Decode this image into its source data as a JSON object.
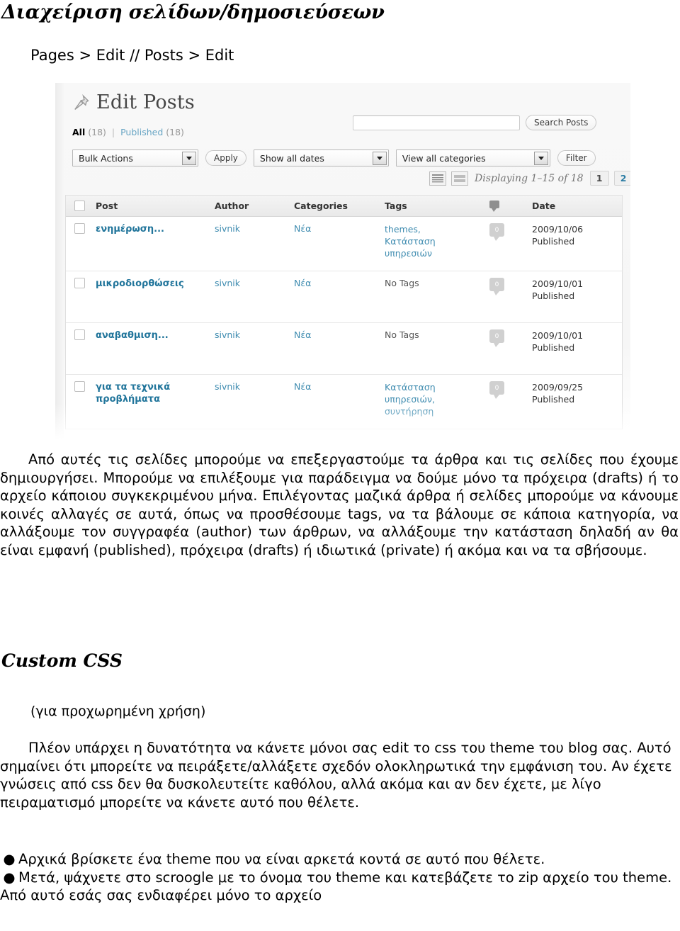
{
  "document": {
    "title": "Διαχείριση σελίδων/δημοσιεύσεων",
    "breadcrumb": "Pages > Edit // Posts > Edit"
  },
  "screenshot": {
    "header": {
      "icon": "pushpin-icon",
      "title": "Edit Posts"
    },
    "filter_links": {
      "all_label": "All",
      "all_count": "(18)",
      "separator": "|",
      "published_label": "Published",
      "published_count": "(18)"
    },
    "search": {
      "value": "",
      "placeholder": "",
      "button_label": "Search Posts"
    },
    "toolbar": {
      "bulk_actions": "Bulk Actions",
      "apply_label": "Apply",
      "show_all_dates": "Show all dates",
      "view_all_categories": "View all categories",
      "filter_label": "Filter"
    },
    "pagination": {
      "list_view_icon": "list-view-icon",
      "excerpt_view_icon": "excerpt-view-icon",
      "displaying": "Displaying 1–15 of 18",
      "page_current": "1",
      "page_next": "2",
      "next_arrow": "»"
    },
    "table": {
      "columns": [
        "Post",
        "Author",
        "Categories",
        "Tags",
        "comments-icon",
        "Date"
      ],
      "headers": {
        "post": "Post",
        "author": "Author",
        "categories": "Categories",
        "tags": "Tags",
        "date": "Date"
      },
      "rows": [
        {
          "post": "ενημέρωση...",
          "author": "sivnik",
          "categories": "Νέα",
          "tags": [
            "themes,",
            "Κατάσταση",
            "υπηρεσιών"
          ],
          "comments": "0",
          "date": "2009/10/06",
          "status": "Published"
        },
        {
          "post": "μικροδιορθώσεις",
          "author": "sivnik",
          "categories": "Νέα",
          "tags": [
            "No Tags"
          ],
          "comments": "0",
          "date": "2009/10/01",
          "status": "Published"
        },
        {
          "post": "αναβαθμιση...",
          "author": "sivnik",
          "categories": "Νέα",
          "tags": [
            "No Tags"
          ],
          "comments": "0",
          "date": "2009/10/01",
          "status": "Published"
        },
        {
          "post": "για τα τεχνικά προβλήματα",
          "author": "sivnik",
          "categories": "Νέα",
          "tags": [
            "Κατάσταση",
            "υπηρεσιών,",
            "συντήρηση"
          ],
          "comments": "0",
          "date": "2009/09/25",
          "status": "Published"
        }
      ]
    }
  },
  "content": {
    "paragraph_1": "Από αυτές τις σελίδες μπορούμε να επεξεργαστούμε τα άρθρα και τις σελίδες που έχουμε δημιουργήσει. Μπορούμε να επιλέξουμε για παράδειγμα να δούμε μόνο τα πρόχειρα (drafts) ή το αρχείο κάποιου συγκεκριμένου μήνα. Επιλέγοντας μαζικά άρθρα ή σελίδες μπορούμε να κάνουμε κοινές αλλαγές σε αυτά, όπως να προσθέσουμε tags, να τα βάλουμε σε κάποια κατηγορία, να αλλάξουμε τον συγγραφέα (author) των άρθρων, να αλλάξουμε την κατάσταση δηλαδή αν θα είναι εμφανή (published), πρόχειρα (drafts) ή ιδιωτικά (private) ή ακόμα και να τα σβήσουμε.",
    "heading_custom_css": "Custom CSS",
    "subnote": "(για προχωρημένη χρήση)",
    "paragraph_2": "Πλέον υπάρχει η δυνατότητα να κάνετε μόνοι σας edit το css του theme του blog σας. Αυτό σημαίνει ότι μπορείτε να πειράξετε/αλλάξετε σχεδόν ολοκληρωτικά την εμφάνιση του. Αν έχετε γνώσεις από css δεν θα δυσκολευτείτε καθόλου, αλλά ακόμα και αν δεν έχετε, με λίγο πειραματισμό μπορείτε να κάνετε αυτό που θέλετε.",
    "bullets": [
      "Αρχικά βρίσκετε ένα theme που να είναι αρκετά κοντά σε αυτό που θέλετε.",
      "Μετά, ψάχνετε στο scroogle με το όνομα του theme και κατεβάζετε το zip αρχείο του theme. Από αυτό εσάς σας ενδιαφέρει μόνο το αρχείο"
    ],
    "bullet_glyph": "●"
  },
  "colors": {
    "link_blue": "#21759b",
    "muted_blue": "#3f8cb0",
    "wp_grey": "#464646"
  }
}
